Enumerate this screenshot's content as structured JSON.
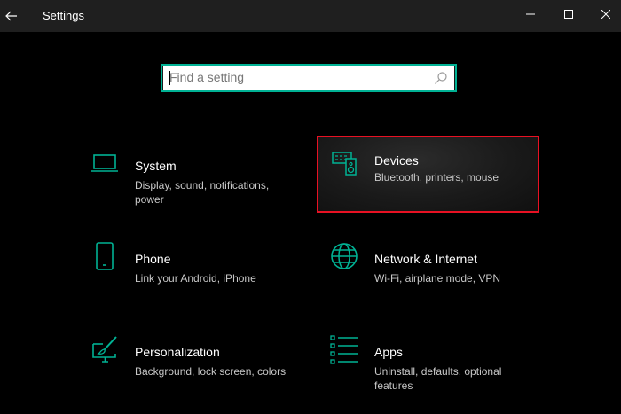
{
  "window": {
    "title": "Settings",
    "accent_color": "#00b294",
    "highlight_color": "#e81123"
  },
  "search": {
    "placeholder": "Find a setting",
    "value": ""
  },
  "categories": [
    {
      "name": "System",
      "description": "Display, sound, notifications, power",
      "icon": "laptop-icon"
    },
    {
      "name": "Devices",
      "description": "Bluetooth, printers, mouse",
      "icon": "keyboard-speaker-icon",
      "highlighted": true
    },
    {
      "name": "Phone",
      "description": "Link your Android, iPhone",
      "icon": "phone-icon"
    },
    {
      "name": "Network & Internet",
      "description": "Wi-Fi, airplane mode, VPN",
      "icon": "globe-icon"
    },
    {
      "name": "Personalization",
      "description": "Background, lock screen, colors",
      "icon": "paint-icon"
    },
    {
      "name": "Apps",
      "description": "Uninstall, defaults, optional features",
      "icon": "apps-list-icon"
    }
  ]
}
